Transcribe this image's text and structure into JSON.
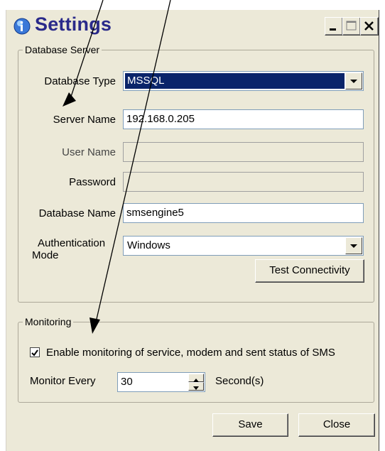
{
  "window": {
    "title": "Settings",
    "controls": {
      "minimize": "_",
      "maximize": "□",
      "close": "✕"
    }
  },
  "database_server": {
    "legend": "Database Server",
    "database_type_label": "Database Type",
    "database_type_value": "MSSQL",
    "server_name_label": "Server Name",
    "server_name_value": "192.168.0.205",
    "user_name_label": "User Name",
    "user_name_value": "",
    "password_label": "Password",
    "password_value": "",
    "database_name_label": "Database Name",
    "database_name_value": "smsengine5",
    "auth_mode_label_line1": "Authentication",
    "auth_mode_label_line2": "Mode",
    "auth_mode_value": "Windows",
    "test_button": "Test Connectivity"
  },
  "monitoring": {
    "legend": "Monitoring",
    "enable_checked": true,
    "enable_label": "Enable monitoring of service, modem and sent status of SMS",
    "monitor_every_label": "Monitor Every",
    "monitor_every_value": "30",
    "unit_label": "Second(s)"
  },
  "footer": {
    "save_button": "Save",
    "close_button": "Close"
  },
  "icons": {
    "app": "info-globe-icon",
    "dropdown": "chevron-down-icon",
    "spinner_up": "triangle-up-icon",
    "spinner_down": "triangle-down-icon",
    "check": "checkmark-icon"
  },
  "colors": {
    "title_text": "#2a2a8a",
    "selected_bg": "#0a246a",
    "window_bg": "#ece9d8"
  }
}
